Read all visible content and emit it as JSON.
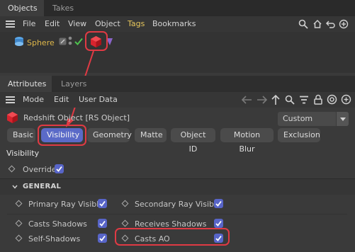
{
  "objects_manager": {
    "tabs": [
      {
        "label": "Objects",
        "active": true
      },
      {
        "label": "Takes",
        "active": false
      }
    ],
    "menu": [
      "File",
      "Edit",
      "View",
      "Object",
      "Tags",
      "Bookmarks"
    ],
    "object_row": {
      "name": "Sphere"
    }
  },
  "attributes_manager": {
    "tabs": [
      {
        "label": "Attributes",
        "active": true
      },
      {
        "label": "Layers",
        "active": false
      }
    ],
    "menu": [
      "Mode",
      "Edit",
      "User Data"
    ],
    "object_type": "Redshift Object [RS Object]",
    "mode_dropdown": "Custom",
    "pills": [
      {
        "label": "Basic",
        "active": false
      },
      {
        "label": "Visibility",
        "active": true
      },
      {
        "label": "Geometry",
        "active": false
      },
      {
        "label": "Matte",
        "active": false
      },
      {
        "label": "Object ID",
        "active": false
      },
      {
        "label": "Motion Blur",
        "active": false
      },
      {
        "label": "Exclusion",
        "active": false
      }
    ],
    "section_title": "Visibility",
    "override": {
      "label": "Override",
      "checked": true
    },
    "group_title": "GENERAL",
    "params": [
      {
        "label": "Primary Ray Visible",
        "checked": true
      },
      {
        "label": "Secondary Ray Visible",
        "checked": true
      },
      {
        "label": "Casts Shadows",
        "checked": true
      },
      {
        "label": "Receives Shadows",
        "checked": true
      },
      {
        "label": "Self-Shadows",
        "checked": true
      },
      {
        "label": "Casts AO",
        "checked": true
      }
    ]
  },
  "colors": {
    "accent": "#5a6ac8",
    "highlight": "#e03a44",
    "tags_menu": "#e6c65c"
  },
  "icons": {
    "object": "sphere-icon",
    "tag": "redshift-object-tag-icon",
    "toolbar": [
      "search-icon",
      "home-icon",
      "back-icon",
      "panel-icon",
      "add-icon"
    ],
    "attributes_toolbar": [
      "back-arrow-icon",
      "forward-arrow-icon",
      "up-arrow-icon",
      "search-icon",
      "filter-icon",
      "lock-icon",
      "target-icon",
      "add-icon"
    ]
  }
}
